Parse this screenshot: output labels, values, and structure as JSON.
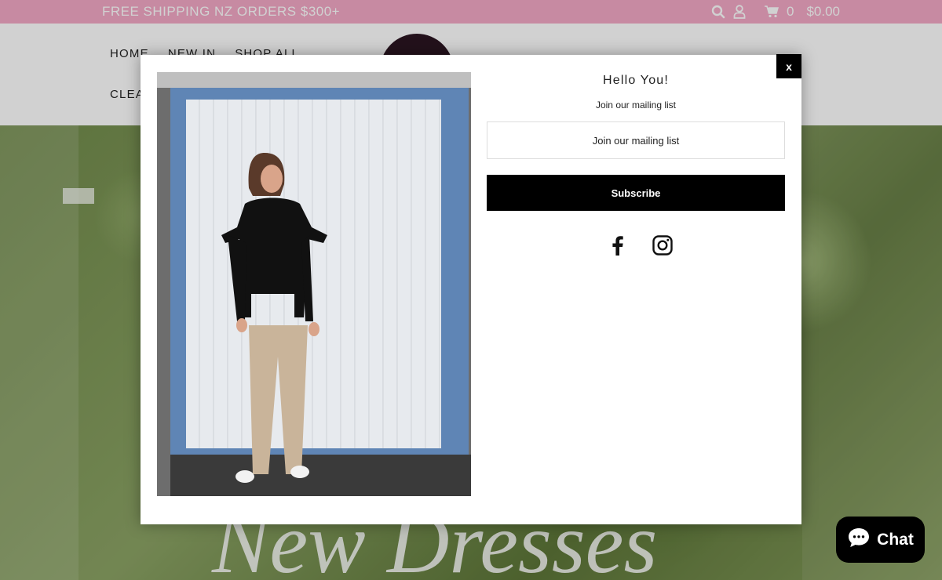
{
  "announcement": {
    "text": "FREE SHIPPING NZ ORDERS $300+"
  },
  "header_icons": {
    "cart_count": "0",
    "cart_total": "$0.00"
  },
  "nav": {
    "items": [
      {
        "label": "HOME"
      },
      {
        "label": "NEW IN"
      },
      {
        "label": "SHOP ALL"
      }
    ],
    "second_row_label": "CLEA"
  },
  "hero": {
    "text": "New Dresses"
  },
  "modal": {
    "close_label": "x",
    "title": "Hello You!",
    "subtitle": "Join our mailing list",
    "email_placeholder": "Join our mailing list",
    "subscribe_label": "Subscribe",
    "social": [
      "facebook-icon",
      "instagram-icon"
    ]
  },
  "chat": {
    "label": "Chat"
  },
  "colors": {
    "announcement_bg": "#f3a9c6",
    "button_bg": "#000000"
  }
}
